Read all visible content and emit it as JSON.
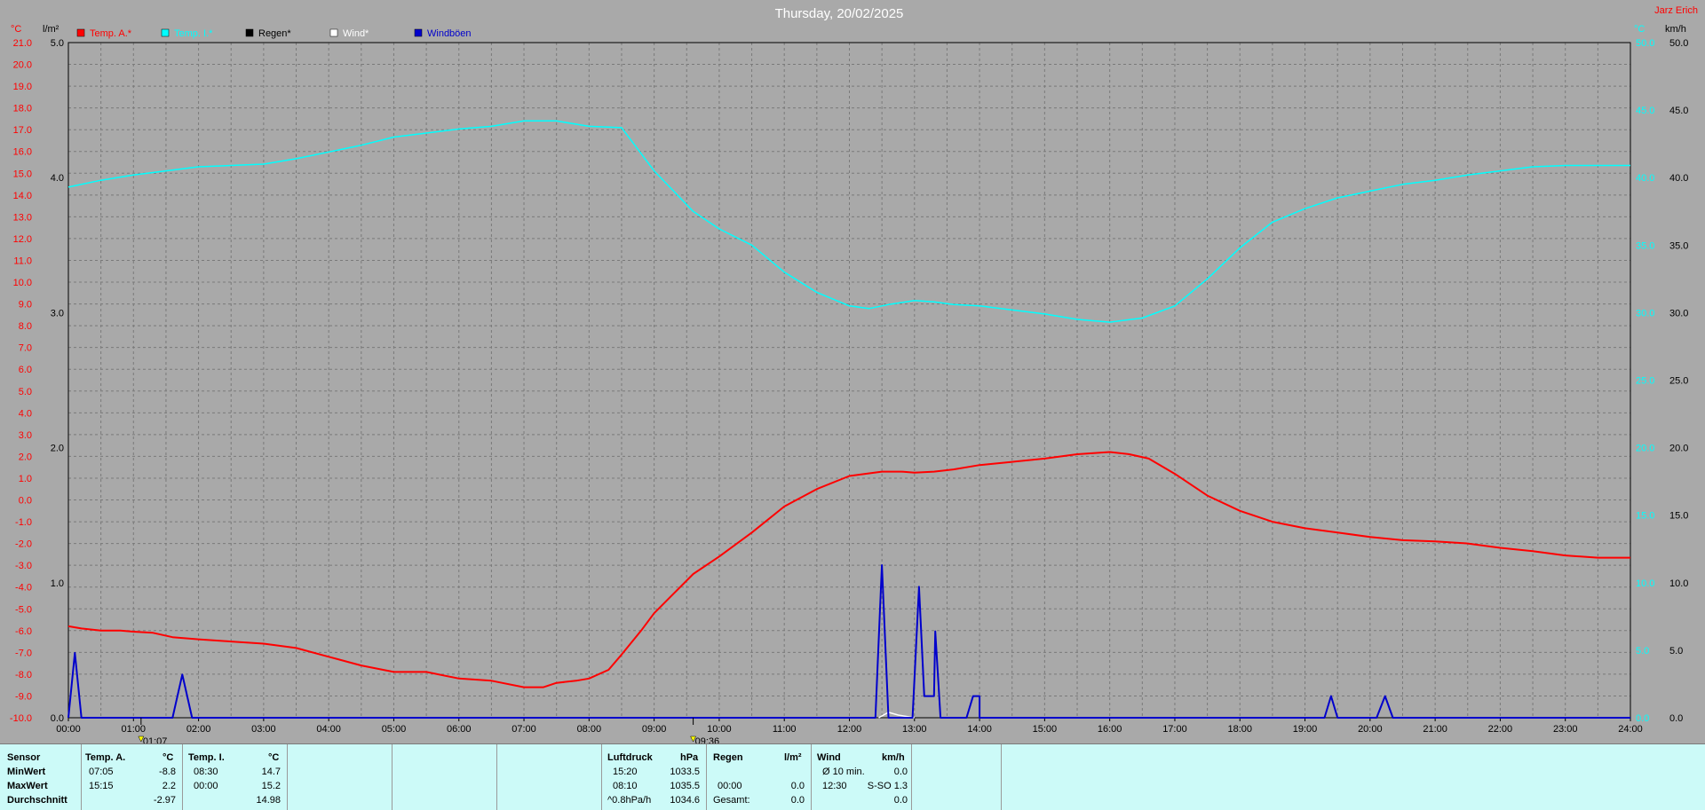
{
  "title": "Thursday, 20/02/2025",
  "station": "Jarz Erich",
  "colors": {
    "temp": "#ff0000",
    "temp_inside": "#00ffff",
    "rain": "#000000",
    "wind": "#ffffff",
    "gusts": "#0000cc",
    "plot_bg": "#a9a9a9",
    "grid": "#7a7a7a"
  },
  "axis_units": {
    "temp": "°C",
    "rain": "l/m²",
    "inside": "°C",
    "wind": "km/h"
  },
  "legend": [
    {
      "label": "Temp. A.*",
      "color": "#ff0000"
    },
    {
      "label": "Temp. I.*",
      "color": "#00ffff"
    },
    {
      "label": "Regen*",
      "color": "#000000"
    },
    {
      "label": "Wind*",
      "color": "#ffffff"
    },
    {
      "label": "Windböen",
      "color": "#0000cc"
    }
  ],
  "markers": [
    "01:07",
    "09:36"
  ],
  "chart_data": {
    "type": "line",
    "x_unit": "time of day (hours)",
    "xlim": [
      0,
      24
    ],
    "x_ticks": [
      "00:00",
      "01:00",
      "02:00",
      "03:00",
      "04:00",
      "05:00",
      "06:00",
      "07:00",
      "08:00",
      "09:00",
      "10:00",
      "11:00",
      "12:00",
      "13:00",
      "14:00",
      "15:00",
      "16:00",
      "17:00",
      "18:00",
      "19:00",
      "20:00",
      "21:00",
      "22:00",
      "23:00",
      "24:00"
    ],
    "y_left_temp": {
      "ylim": [
        -10,
        21
      ],
      "ticks": [
        "21.0",
        "20.0",
        "19.0",
        "18.0",
        "17.0",
        "16.0",
        "15.0",
        "14.0",
        "13.0",
        "12.0",
        "11.0",
        "10.0",
        "9.0",
        "8.0",
        "7.0",
        "6.0",
        "5.0",
        "4.0",
        "3.0",
        "2.0",
        "1.0",
        "0.0",
        "-1.0",
        "-2.0",
        "-3.0",
        "-4.0",
        "-5.0",
        "-6.0",
        "-7.0",
        "-8.0",
        "-9.0",
        "-10.0"
      ]
    },
    "y_left_rain": {
      "ylim": [
        0,
        5
      ],
      "ticks": [
        "5.0",
        "4.0",
        "3.0",
        "2.0",
        "1.0",
        "0.0"
      ]
    },
    "y_right_inside": {
      "ylim": [
        0,
        50
      ],
      "ticks": [
        "50.0",
        "45.0",
        "40.0",
        "35.0",
        "30.0",
        "25.0",
        "20.0",
        "15.0",
        "10.0",
        "5.0",
        "0.0"
      ]
    },
    "y_right_wind": {
      "ylim": [
        0,
        50
      ],
      "ticks": [
        "50.0",
        "45.0",
        "40.0",
        "35.0",
        "30.0",
        "25.0",
        "20.0",
        "15.0",
        "10.0",
        "5.0",
        "0.0"
      ]
    },
    "series": [
      {
        "name": "Temp. A.*",
        "axis": "temp",
        "x": [
          0,
          0.2,
          0.5,
          0.8,
          1.0,
          1.3,
          1.6,
          2.0,
          2.5,
          3.0,
          3.5,
          4.0,
          4.5,
          5.0,
          5.5,
          6.0,
          6.5,
          7.0,
          7.3,
          7.5,
          7.8,
          8.0,
          8.3,
          8.5,
          8.8,
          9.0,
          9.3,
          9.6,
          10.0,
          10.5,
          11.0,
          11.5,
          12.0,
          12.5,
          12.8,
          13.0,
          13.3,
          13.6,
          14.0,
          14.5,
          15.0,
          15.5,
          16.0,
          16.3,
          16.6,
          17.0,
          17.5,
          18.0,
          18.5,
          19.0,
          19.5,
          20.0,
          20.5,
          21.0,
          21.5,
          22.0,
          22.5,
          23.0,
          23.5,
          24.0
        ],
        "y": [
          -5.8,
          -5.9,
          -6.0,
          -6.0,
          -6.05,
          -6.1,
          -6.3,
          -6.4,
          -6.5,
          -6.6,
          -6.8,
          -7.2,
          -7.6,
          -7.9,
          -7.9,
          -8.2,
          -8.3,
          -8.6,
          -8.6,
          -8.4,
          -8.3,
          -8.2,
          -7.8,
          -7.1,
          -6.0,
          -5.2,
          -4.3,
          -3.4,
          -2.6,
          -1.5,
          -0.3,
          0.5,
          1.1,
          1.3,
          1.3,
          1.25,
          1.3,
          1.4,
          1.6,
          1.75,
          1.9,
          2.1,
          2.2,
          2.1,
          1.9,
          1.2,
          0.2,
          -0.5,
          -1.0,
          -1.3,
          -1.5,
          -1.7,
          -1.85,
          -1.9,
          -2.0,
          -2.2,
          -2.35,
          -2.55,
          -2.65,
          -2.65
        ]
      },
      {
        "name": "Temp. I.*",
        "axis": "inside",
        "x": [
          0,
          0.5,
          1.0,
          1.5,
          2.0,
          2.5,
          3.0,
          3.5,
          4.0,
          4.5,
          5.0,
          5.5,
          6.0,
          6.5,
          7.0,
          7.5,
          8.0,
          8.5,
          9.0,
          9.3,
          9.6,
          10.0,
          10.5,
          11.0,
          11.5,
          12.0,
          12.3,
          12.6,
          13.0,
          13.3,
          13.6,
          14.0,
          14.5,
          15.0,
          15.5,
          16.0,
          16.5,
          17.0,
          17.5,
          18.0,
          18.5,
          19.0,
          19.5,
          20.0,
          20.5,
          21.0,
          21.5,
          22.0,
          22.5,
          23.0,
          23.5,
          24.0
        ],
        "y": [
          39.3,
          39.8,
          40.2,
          40.5,
          40.8,
          40.9,
          41.0,
          41.4,
          41.9,
          42.4,
          43.0,
          43.3,
          43.6,
          43.8,
          44.2,
          44.2,
          43.8,
          43.7,
          40.5,
          39.0,
          37.5,
          36.2,
          35.0,
          33.0,
          31.5,
          30.5,
          30.3,
          30.6,
          30.9,
          30.8,
          30.6,
          30.5,
          30.2,
          29.9,
          29.5,
          29.3,
          29.6,
          30.5,
          32.5,
          34.8,
          36.7,
          37.7,
          38.5,
          39.0,
          39.5,
          39.8,
          40.2,
          40.5,
          40.8,
          40.9,
          40.9,
          40.9
        ]
      },
      {
        "name": "Wind*",
        "axis": "wind",
        "x": [
          12.45,
          12.6,
          12.75,
          13.0
        ],
        "y": [
          0,
          0.4,
          0.2,
          0
        ]
      },
      {
        "name": "Windböen",
        "axis": "wind",
        "x": [
          0,
          0.1,
          0.2,
          1.6,
          1.75,
          1.9,
          1.9,
          12.4,
          12.5,
          12.6,
          12.6,
          12.97,
          13.07,
          13.15,
          13.3,
          13.32,
          13.4,
          13.4,
          13.8,
          13.9,
          14.0,
          14.0,
          19.3,
          19.4,
          19.5,
          19.5,
          20.1,
          20.23,
          20.35,
          20.35,
          24.0
        ],
        "y": [
          0,
          4.8,
          0,
          0,
          3.2,
          0,
          0,
          0,
          11.3,
          0,
          0,
          0,
          9.7,
          1.6,
          1.6,
          6.4,
          0,
          0,
          0,
          1.6,
          1.6,
          0,
          0,
          1.6,
          0,
          0,
          0,
          1.6,
          0,
          0,
          0
        ]
      },
      {
        "name": "Regen*",
        "axis": "rain",
        "x": [
          0,
          24
        ],
        "y": [
          0,
          0
        ]
      }
    ]
  },
  "stats": {
    "sensor": {
      "header": "Sensor",
      "rows": [
        "MinWert",
        "MaxWert",
        "Durchschnitt"
      ]
    },
    "temp_out": {
      "header": "Temp. A.",
      "unit": "°C",
      "rows": [
        [
          "07:05",
          "-8.8"
        ],
        [
          "15:15",
          "2.2"
        ],
        [
          "",
          "-2.97"
        ]
      ]
    },
    "temp_in": {
      "header": "Temp. I.",
      "unit": "°C",
      "rows": [
        [
          "08:30",
          "14.7"
        ],
        [
          "00:00",
          "15.2"
        ],
        [
          "",
          "14.98"
        ]
      ]
    },
    "pressure": {
      "header": "Luftdruck",
      "unit": "hPa",
      "rows": [
        [
          "15:20",
          "1033.5"
        ],
        [
          "08:10",
          "1035.5"
        ],
        [
          "^0.8hPa/h",
          "1034.6"
        ]
      ]
    },
    "rain": {
      "header": "Regen",
      "unit": "l/m²",
      "rows": [
        [
          "",
          ""
        ],
        [
          "00:00",
          "0.0"
        ],
        [
          "Gesamt:",
          "0.0"
        ]
      ]
    },
    "wind": {
      "header": "Wind",
      "unit": "km/h",
      "rows": [
        [
          "Ø 10 min.",
          "0.0"
        ],
        [
          "12:30",
          "S-SO 1.3"
        ],
        [
          "",
          "0.0"
        ]
      ]
    }
  }
}
